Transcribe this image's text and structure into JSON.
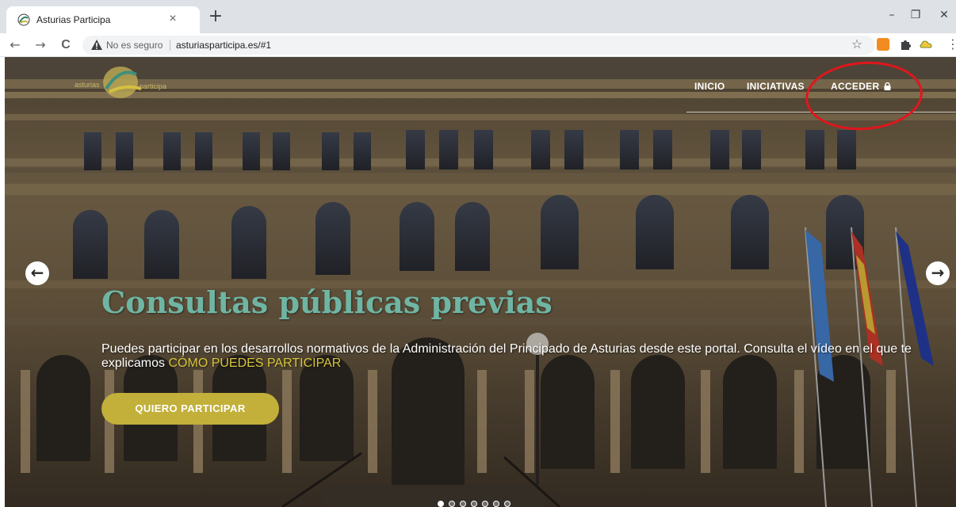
{
  "browser": {
    "tab": {
      "title": "Asturias Participa",
      "close_glyph": "×"
    },
    "new_tab_glyph": "+",
    "window_controls": {
      "minimize": "–",
      "restore": "❐",
      "close": "✕"
    },
    "nav": {
      "back": "←",
      "forward": "→",
      "reload": "C"
    },
    "address": {
      "security_label": "No es seguro",
      "url": "asturiasparticipa.es/#1"
    },
    "star_glyph": "☆",
    "menu_glyph": "⋮",
    "extension_colors": [
      "#f28b20",
      "#3c4043",
      "#f4c542"
    ]
  },
  "site": {
    "logo": {
      "alt": "asturias participa",
      "word_left": "asturias",
      "word_right": "participa"
    },
    "nav": [
      {
        "label": "INICIO"
      },
      {
        "label": "INICIATIVAS"
      },
      {
        "label": "ACCEDER"
      }
    ],
    "hero": {
      "title": "Consultas públicas previas",
      "description": "Puedes participar en los desarrollos normativos de la Administración del Principado de Asturias desde este portal. Consulta el vídeo en el que te explicamos ",
      "link_text": "CÓMO PUEDES PARTICIPAR",
      "cta": "QUIERO PARTICIPAR",
      "prev_glyph": "←",
      "next_glyph": "→",
      "slide_count": 7
    },
    "colors": {
      "title": "#6fb5a4",
      "link": "#d7c53a",
      "cta": "#c2b03a",
      "annotation": "#e0161c"
    }
  }
}
